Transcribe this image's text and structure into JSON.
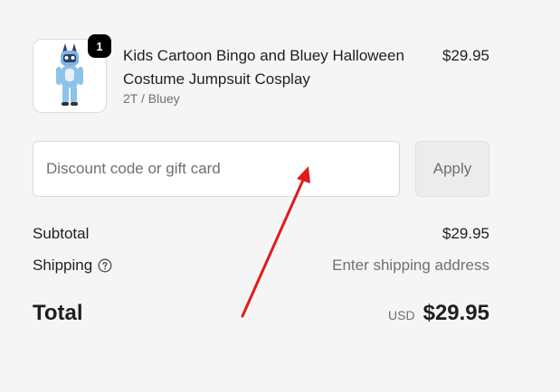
{
  "cart_item": {
    "title": "Kids Cartoon Bingo and Bluey Halloween Costume Jumpsuit Cosplay",
    "variant": "2T / Bluey",
    "price": "$29.95",
    "quantity": "1",
    "image_icon": "costume-thumbnail"
  },
  "discount": {
    "placeholder": "Discount code or gift card",
    "value": "",
    "apply_label": "Apply"
  },
  "summary": {
    "subtotal_label": "Subtotal",
    "subtotal_value": "$29.95",
    "shipping_label": "Shipping",
    "shipping_help_icon": "question-circle-icon",
    "shipping_value": "Enter shipping address",
    "total_label": "Total",
    "currency": "USD",
    "total_value": "$29.95"
  },
  "annotation": {
    "arrow_color": "#e01b1b"
  }
}
